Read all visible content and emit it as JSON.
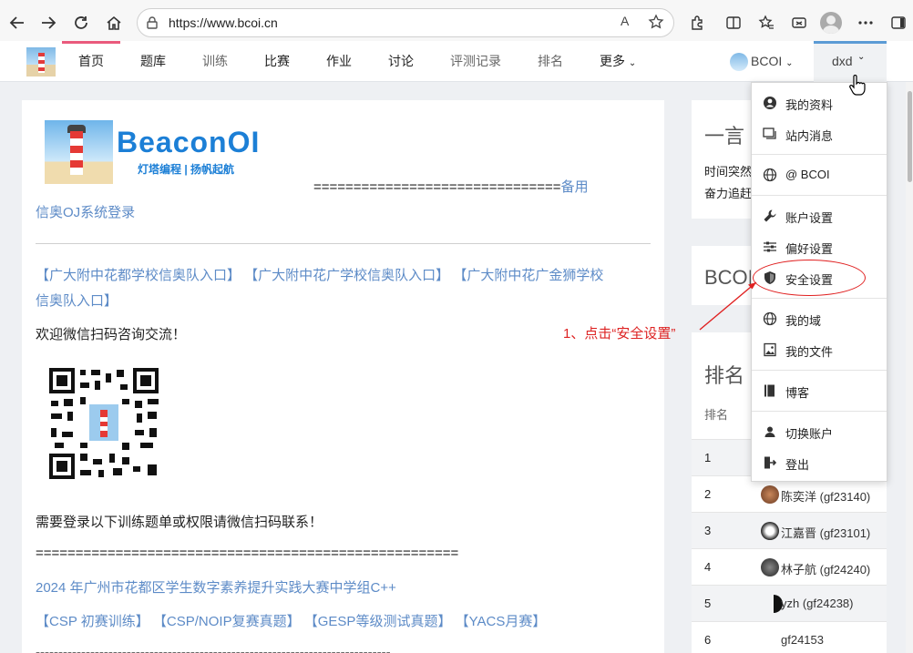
{
  "browser": {
    "url": "https://www.bcoi.cn",
    "read_aloud": "A",
    "icons": [
      "back-icon",
      "forward-icon",
      "refresh-icon",
      "home-icon",
      "lock-icon",
      "read-aloud-icon",
      "favorite-star-icon",
      "extensions-icon",
      "split-screen-icon",
      "favorites-icon",
      "browser-essentials-icon",
      "profile-icon",
      "more-icon",
      "sidebar-icon"
    ]
  },
  "sitenav": {
    "items": [
      "首页",
      "题库",
      "训练",
      "比赛",
      "作业",
      "讨论",
      "评测记录",
      "排名",
      "更多"
    ],
    "domain": "BCOI",
    "user": "dxd"
  },
  "main": {
    "brand_name": "BeaconOI",
    "brand_tagline": "灯塔编程 | 扬帆起航",
    "backup_prefix": "===============================",
    "backup_link": "备用",
    "backup_link2": "信奥OJ系统登录",
    "entries": "【广大附中花都学校信奥队入口】 【广大附中花广学校信奥队入口】 【广大附中花广金狮学校",
    "entries2": "信奥队入口】",
    "wechat_text": "欢迎微信扫码咨询交流！",
    "login_text": "需要登录以下训练题单或权限请微信扫码联系！",
    "equals_line": "=====================================================",
    "contest_link": "2024 年广州市花都区学生数字素养提升实践大赛中学组C++",
    "tags": "【CSP 初赛训练】 【CSP/NOIP复赛真题】 【GESP等级测试真题】 【YACS月赛】",
    "dash_line": "------------------------------------------------------------------------------"
  },
  "side": {
    "yiyan_title": "一言",
    "yiyan_text1": "时间突然",
    "yiyan_text2": "奋力追赶",
    "bcoi_title": "BCOI",
    "rank_title": "排名",
    "rank_col": "排名",
    "rows": [
      {
        "num": "1",
        "user": ""
      },
      {
        "num": "2",
        "user": "陈奕洋 (gf23140)"
      },
      {
        "num": "3",
        "user": "江嘉晋 (gf23101)"
      },
      {
        "num": "4",
        "user": "林子航 (gf24240)"
      },
      {
        "num": "5",
        "user": "yzh (gf24238)"
      },
      {
        "num": "6",
        "user": "gf24153"
      }
    ]
  },
  "dropdown": {
    "items": [
      {
        "label": "我的资料",
        "icon": "profile-circle-icon"
      },
      {
        "label": "站内消息",
        "icon": "messages-icon"
      },
      {
        "label": "@ BCOI",
        "icon": "globe-icon"
      },
      {
        "label": "账户设置",
        "icon": "wrench-icon"
      },
      {
        "label": "偏好设置",
        "icon": "sliders-icon"
      },
      {
        "label": "安全设置",
        "icon": "shield-icon"
      },
      {
        "label": "我的域",
        "icon": "globe-icon"
      },
      {
        "label": "我的文件",
        "icon": "image-file-icon"
      },
      {
        "label": "博客",
        "icon": "book-icon"
      },
      {
        "label": "切换账户",
        "icon": "user-icon"
      },
      {
        "label": "登出",
        "icon": "logout-icon"
      }
    ]
  },
  "annotation": "1、点击“安全设置”",
  "colors": {
    "accent": "#1c7fd6",
    "link": "#5d8bc7",
    "annot": "#dd2222",
    "active": "#ea5a7c"
  }
}
